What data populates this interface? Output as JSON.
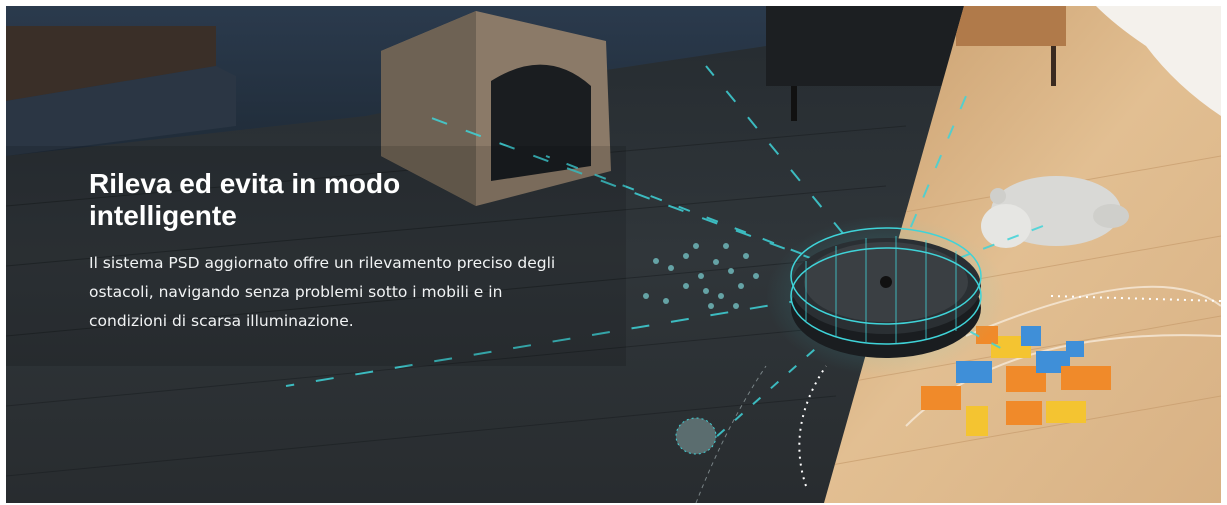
{
  "hero": {
    "headline": "Rileva ed evita in modo intelligente",
    "description": "Il sistema PSD aggiornato offre un rilevamento preciso degli ostacoli, navigando senza problemi sotto i mobili e in condizioni di scarsa illuminazione.",
    "colors": {
      "dark_floor": "#2a3034",
      "light_floor": "#d9b486",
      "scan_lines": "#3fd3d8",
      "text": "#ffffff"
    },
    "illustration": {
      "objects": [
        "robot-vacuum",
        "pet-house",
        "toy-blocks",
        "plush-toy",
        "scattered-debris",
        "small-ball",
        "side-cabinet",
        "curtain"
      ]
    }
  }
}
